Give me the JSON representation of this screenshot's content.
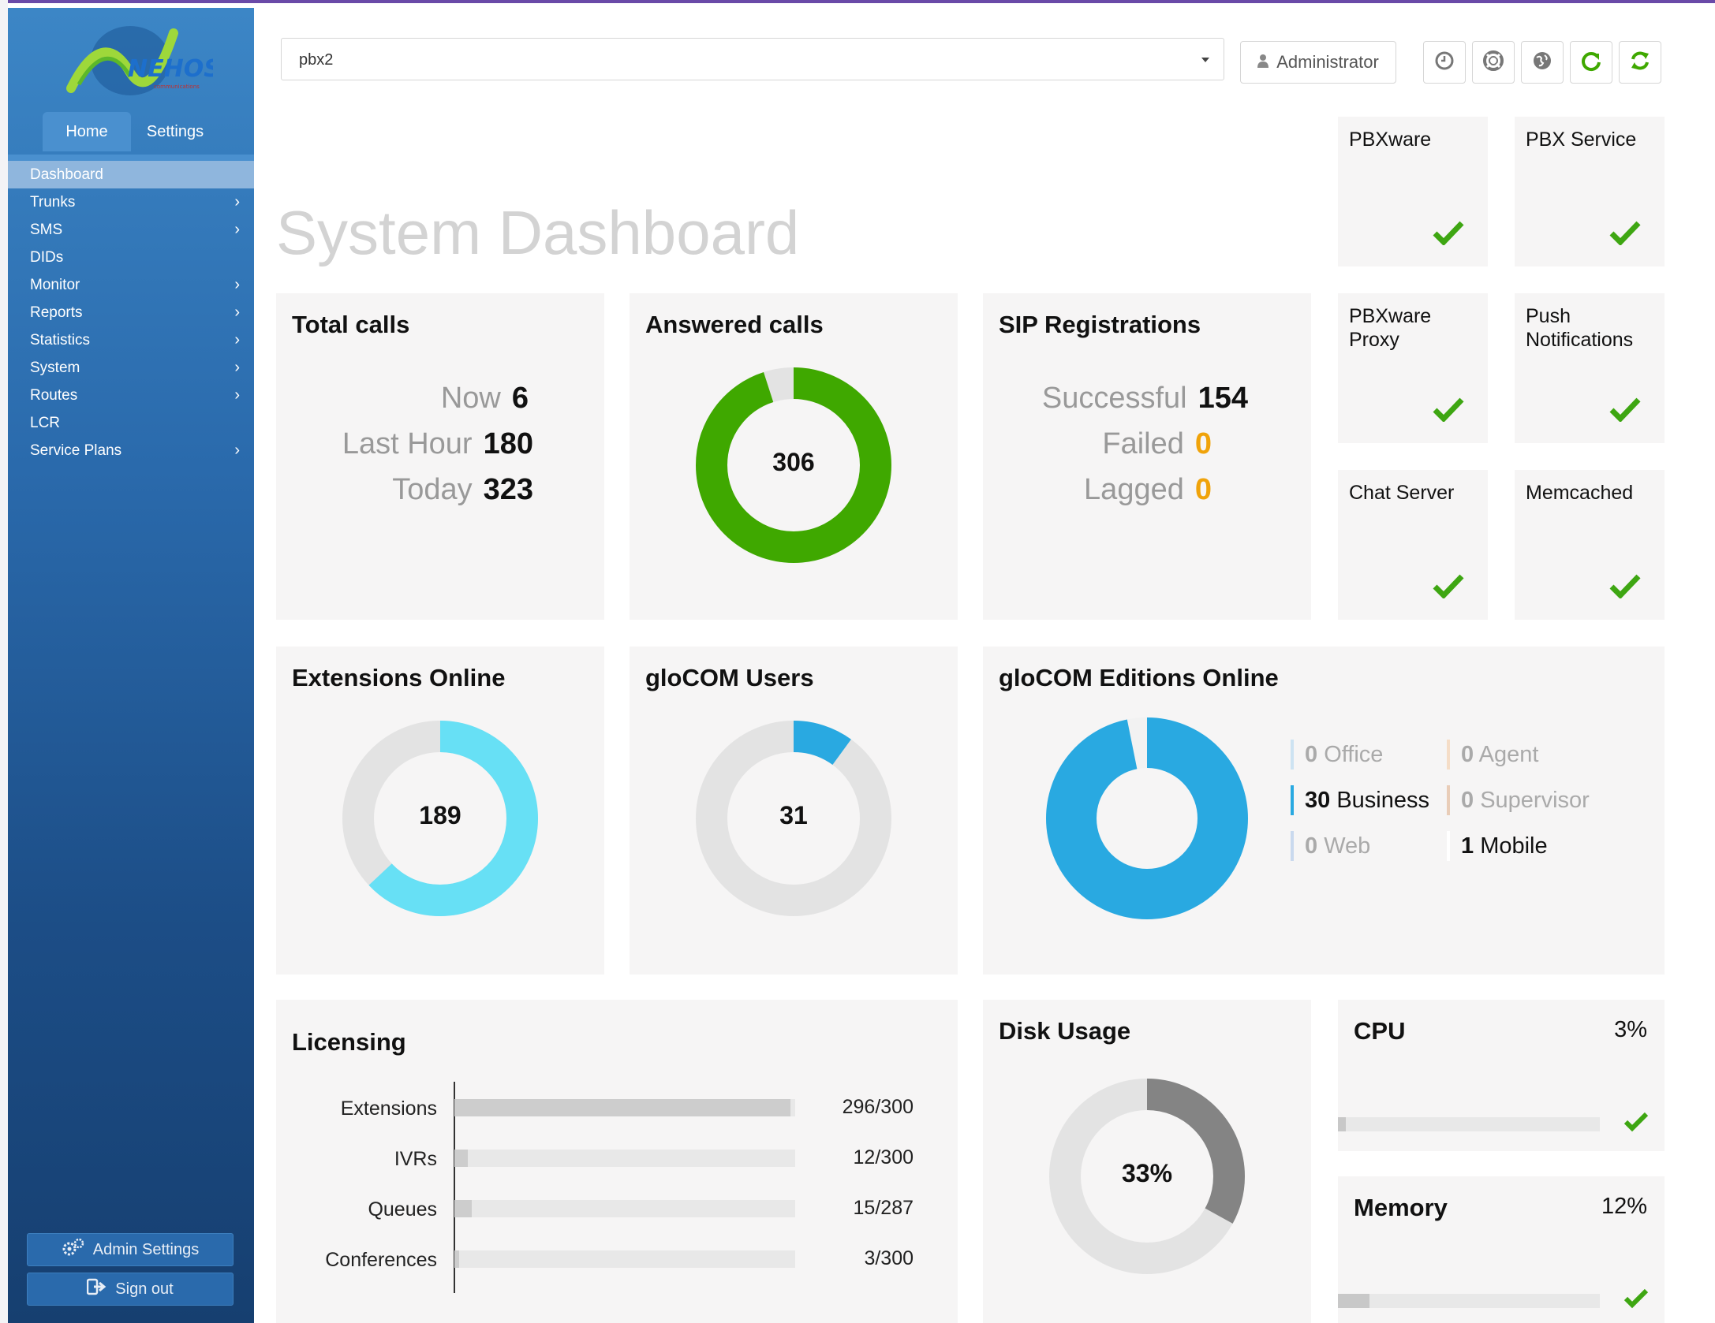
{
  "sidebar": {
    "logo_text": "NEHOS",
    "tabs": [
      {
        "label": "Home"
      },
      {
        "label": "Settings"
      }
    ],
    "items": [
      {
        "label": "Dashboard",
        "has_submenu": false,
        "active": true
      },
      {
        "label": "Trunks",
        "has_submenu": true
      },
      {
        "label": "SMS",
        "has_submenu": true
      },
      {
        "label": "DIDs",
        "has_submenu": false
      },
      {
        "label": "Monitor",
        "has_submenu": true
      },
      {
        "label": "Reports",
        "has_submenu": true
      },
      {
        "label": "Statistics",
        "has_submenu": true
      },
      {
        "label": "System",
        "has_submenu": true
      },
      {
        "label": "Routes",
        "has_submenu": true
      },
      {
        "label": "LCR",
        "has_submenu": false
      },
      {
        "label": "Service Plans",
        "has_submenu": true
      }
    ],
    "admin_settings_label": "Admin Settings",
    "sign_out_label": "Sign out"
  },
  "header": {
    "server_select_value": "pbx2",
    "user_label": "Administrator",
    "icons": [
      "clock-icon",
      "lifebuoy-icon",
      "globe-icon",
      "reload-icon",
      "sync-icon"
    ]
  },
  "page_title": "System Dashboard",
  "services": [
    {
      "label": "PBXware",
      "ok": true
    },
    {
      "label": "PBX Service",
      "ok": true
    },
    {
      "label": "PBXware Proxy",
      "ok": true
    },
    {
      "label": "Push Notifications",
      "ok": true
    },
    {
      "label": "Chat Server",
      "ok": true
    },
    {
      "label": "Memcached",
      "ok": true
    }
  ],
  "total_calls": {
    "title": "Total calls",
    "rows": [
      {
        "label": "Now",
        "value": "6"
      },
      {
        "label": "Last Hour",
        "value": "180"
      },
      {
        "label": "Today",
        "value": "323"
      }
    ]
  },
  "answered_calls": {
    "title": "Answered calls",
    "value": "306",
    "fraction": 0.95
  },
  "sip_registrations": {
    "title": "SIP Registrations",
    "rows": [
      {
        "label": "Successful",
        "value": "154"
      },
      {
        "label": "Failed",
        "value": "0"
      },
      {
        "label": "Lagged",
        "value": "0"
      }
    ]
  },
  "extensions_online": {
    "title": "Extensions Online",
    "value": "189",
    "fraction": 0.63
  },
  "glocom_users": {
    "title": "gloCOM Users",
    "value": "31",
    "fraction": 0.1
  },
  "glocom_editions": {
    "title": "gloCOM Editions Online",
    "fraction_business": 0.968,
    "items": [
      {
        "count": "0",
        "label": "Office"
      },
      {
        "count": "0",
        "label": "Agent"
      },
      {
        "count": "30",
        "label": "Business"
      },
      {
        "count": "0",
        "label": "Supervisor"
      },
      {
        "count": "0",
        "label": "Web"
      },
      {
        "count": "1",
        "label": "Mobile"
      }
    ]
  },
  "licensing": {
    "title": "Licensing",
    "rows": [
      {
        "label": "Extensions",
        "value": "296/300",
        "fraction": 0.987
      },
      {
        "label": "IVRs",
        "value": "12/300",
        "fraction": 0.04
      },
      {
        "label": "Queues",
        "value": "15/287",
        "fraction": 0.052
      },
      {
        "label": "Conferences",
        "value": "3/300",
        "fraction": 0.01
      }
    ]
  },
  "disk_usage": {
    "title": "Disk Usage",
    "value": "33%",
    "fraction": 0.33
  },
  "cpu": {
    "title": "CPU",
    "value": "3%",
    "fraction": 0.03
  },
  "memory": {
    "title": "Memory",
    "value": "12%",
    "fraction": 0.12
  },
  "colors": {
    "green": "#3fa800",
    "cyan": "#67e0f5",
    "blue": "#29a9e1",
    "grey_ring": "#e3e3e3",
    "disk_dark": "#848484",
    "orange": "#f0a30a",
    "check": "#3ea612"
  }
}
